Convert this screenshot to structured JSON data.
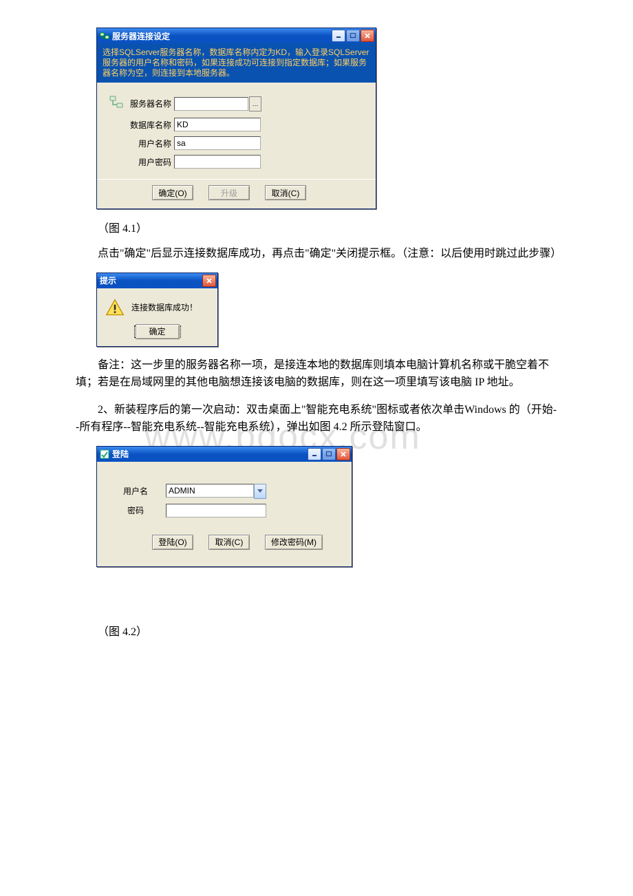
{
  "watermark": "www.bdocx.com",
  "dialog1": {
    "title": "服务器连接设定",
    "instruction": "选择SQLServer服务器名称，数据库名称内定为KD，输入登录SQLServer服务器的用户名称和密码，如果连接成功可连接到指定数据库；如果服务器名称为空，则连接到本地服务器。",
    "labels": {
      "server": "服务器名称",
      "database": "数据库名称",
      "user": "用户名称",
      "password": "用户密码"
    },
    "values": {
      "server": "",
      "database": "KD",
      "user": "sa",
      "password": ""
    },
    "browse": "…",
    "buttons": {
      "ok": "确定(O)",
      "upgrade": "升级",
      "cancel": "取消(C)"
    }
  },
  "caption1": "（图 4.1）",
  "para1": "点击\"确定\"后显示连接数据库成功，再点击\"确定\"关闭提示框。（注意：以后使用时跳过此步骤）",
  "msgbox": {
    "title": "提示",
    "text": "连接数据库成功！",
    "ok": "确定"
  },
  "para2": "备注：这一步里的服务器名称一项，是接连本地的数据库则填本电脑计算机名称或干脆空着不填；若是在局域网里的其他电脑想连接该电脑的数据库，则在这一项里填写该电脑 IP 地址。",
  "para3": "2、新装程序后的第一次启动：双击桌面上\"智能充电系统\"图标或者依次单击Windows 的（开始--所有程序--智能充电系统--智能充电系统），弹出如图 4.2 所示登陆窗口。",
  "login": {
    "title": "登陆",
    "labels": {
      "user": "用户名",
      "password": "密码"
    },
    "values": {
      "user": "ADMIN",
      "password": ""
    },
    "buttons": {
      "login": "登陆(O)",
      "cancel": "取消(C)",
      "changepw": "修改密码(M)"
    }
  },
  "caption2": "（图 4.2）"
}
